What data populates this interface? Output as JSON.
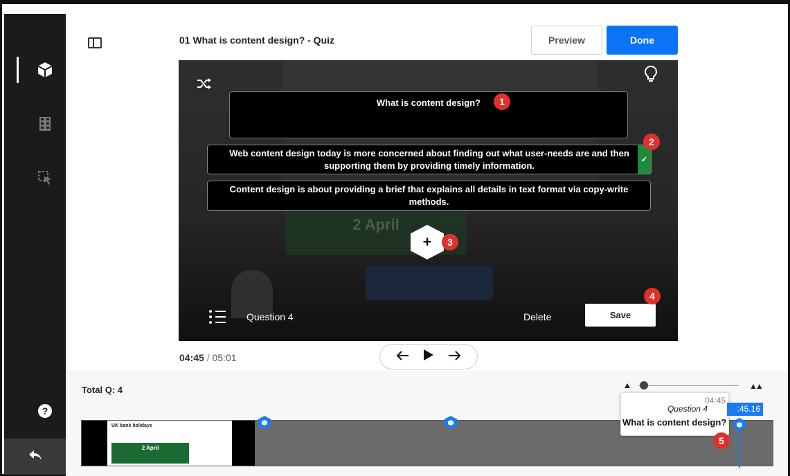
{
  "header": {
    "title": "01 What is content design? - Quiz",
    "preview_label": "Preview",
    "done_label": "Done"
  },
  "quiz": {
    "question": "What is content design?",
    "answers": [
      {
        "text": "Web content design today is more concerned about finding out what user-needs are and then supporting them by providing timely information.",
        "correct": true
      },
      {
        "text": "Content design is about providing a brief that explains all details in text format via copy-write methods.",
        "correct": false
      }
    ],
    "add_symbol": "+",
    "question_label": "Question 4",
    "delete_label": "Delete",
    "save_label": "Save"
  },
  "badges": [
    "1",
    "2",
    "3",
    "4",
    "5"
  ],
  "background_video": {
    "date_text": "2 April"
  },
  "player": {
    "current_time": "04:45",
    "separator": "/",
    "duration": "05:01"
  },
  "timeline": {
    "total_label": "Total Q: 4",
    "thumb_title": "UK bank holidays",
    "thumb_date": "2 April",
    "tooltip": {
      "time": "04:45",
      "question": "Question 4",
      "title": "What is content design?"
    },
    "playhead_time": ":45.16"
  },
  "colors": {
    "accent": "#0a74f5",
    "correct": "#1d8b3a",
    "badge": "#e0302c",
    "sidebar": "#1b1b1b"
  },
  "icons": {
    "sidebar": [
      "cube-icon",
      "film-icon",
      "cursor-select-icon",
      "help-icon",
      "back-icon"
    ],
    "video": [
      "shuffle-icon",
      "lightbulb-icon",
      "list-icon"
    ],
    "player": [
      "arrow-left-icon",
      "play-icon",
      "arrow-right-icon"
    ]
  }
}
